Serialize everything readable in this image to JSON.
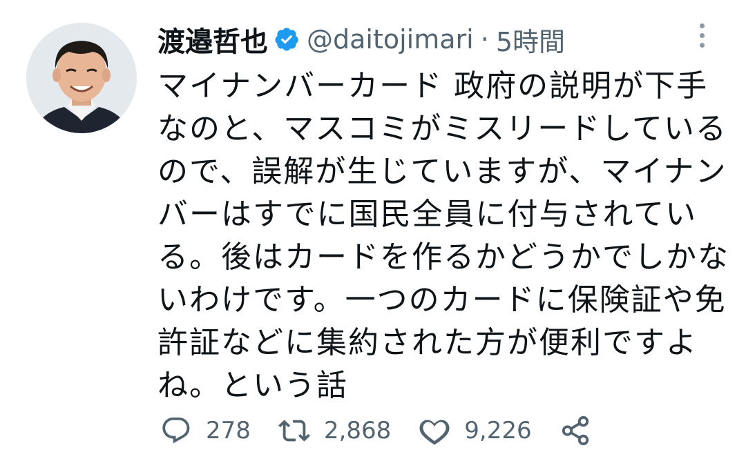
{
  "tweet": {
    "author_name": "渡邉哲也",
    "handle": "@daitojimari",
    "separator": "·",
    "time": "5時間",
    "text_lines": [
      "マイナンバーカード 政府の説明が下手",
      "なのと、マスコミがミスリードしている",
      "ので、誤解が生じていますが、マイナン",
      "バーはすでに国民全員に付与されてい",
      "る。後はカードを作るかどうかでしかな",
      "いわけです。一つのカードに保険証や免",
      "許証などに集約された方が便利ですよ",
      "ね。という話"
    ]
  },
  "icons": {
    "avatar": "user-avatar",
    "verified": "verified-badge-icon",
    "more": "more-vertical-icon",
    "reply": "reply-icon",
    "retweet": "retweet-icon",
    "like": "heart-icon",
    "share": "share-icon"
  },
  "actions": {
    "replies": "278",
    "retweets": "2,868",
    "likes": "9,226"
  },
  "colors": {
    "verified_blue": "#1d9bf0",
    "secondary_text": "#536471",
    "primary_text": "#0f1419"
  }
}
